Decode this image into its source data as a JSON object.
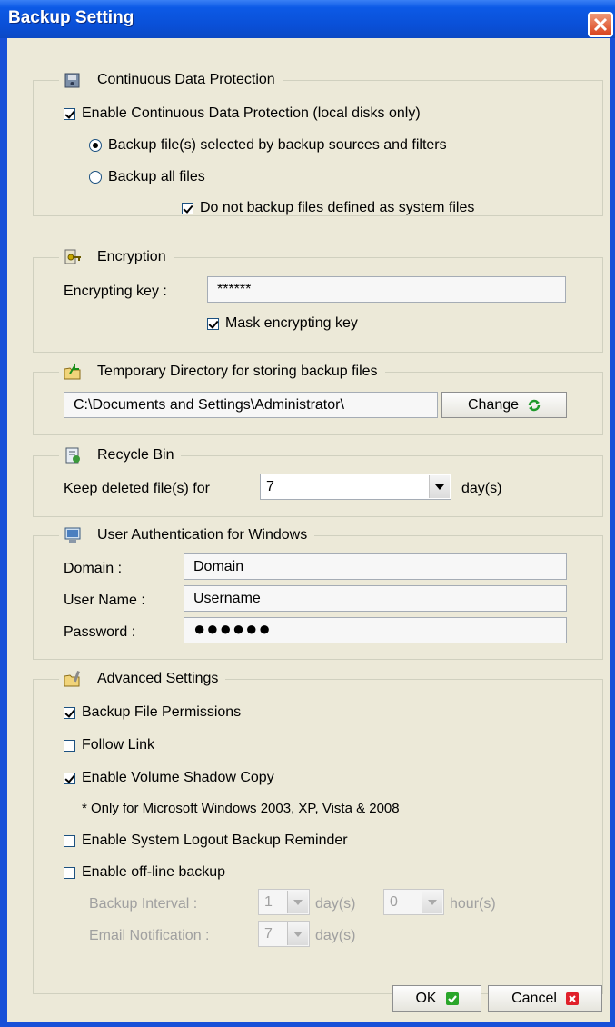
{
  "window": {
    "title": "Backup Setting"
  },
  "cdp": {
    "legend": "Continuous Data Protection",
    "enable_label": "Enable Continuous Data Protection (local disks only)",
    "enable_checked": true,
    "radio_selected_label": "Backup file(s) selected by backup sources and filters",
    "radio_all_label": "Backup all files",
    "selected_option": "selected",
    "no_system_label": "Do not backup files defined as system files",
    "no_system_checked": true
  },
  "encryption": {
    "legend": "Encryption",
    "key_label": "Encrypting key :",
    "key_value": "******",
    "mask_label": "Mask encrypting key",
    "mask_checked": true
  },
  "tempdir": {
    "legend": "Temporary Directory for storing backup files",
    "path_value": "C:\\Documents and Settings\\Administrator\\",
    "change_label": "Change"
  },
  "recycle": {
    "legend": "Recycle Bin",
    "keep_label": "Keep deleted file(s) for",
    "days_value": "7",
    "unit_label": "day(s)"
  },
  "auth": {
    "legend": "User Authentication for Windows",
    "domain_label": "Domain :",
    "domain_value": "Domain",
    "username_label": "User Name :",
    "username_value": "Username",
    "password_label": "Password :",
    "password_value": "●●●●●●"
  },
  "advanced": {
    "legend": "Advanced Settings",
    "permissions_label": "Backup File Permissions",
    "permissions_checked": true,
    "follow_link_label": "Follow Link",
    "follow_link_checked": false,
    "vss_label": "Enable Volume Shadow Copy",
    "vss_checked": true,
    "vss_note": "* Only for Microsoft Windows 2003, XP, Vista & 2008",
    "logout_label": "Enable System Logout Backup Reminder",
    "logout_checked": false,
    "offline_label": "Enable off-line backup",
    "offline_checked": false,
    "interval_label": "Backup Interval :",
    "interval_days_value": "1",
    "interval_days_unit": "day(s)",
    "interval_hours_value": "0",
    "interval_hours_unit": "hour(s)",
    "email_label": "Email Notification :",
    "email_days_value": "7",
    "email_days_unit": "day(s)"
  },
  "footer": {
    "ok_label": "OK",
    "cancel_label": "Cancel"
  },
  "colors": {
    "title_bar": "#0a4fd6",
    "client": "#ece9d8",
    "check_green": "#21a121",
    "cancel_red": "#e0202a"
  }
}
